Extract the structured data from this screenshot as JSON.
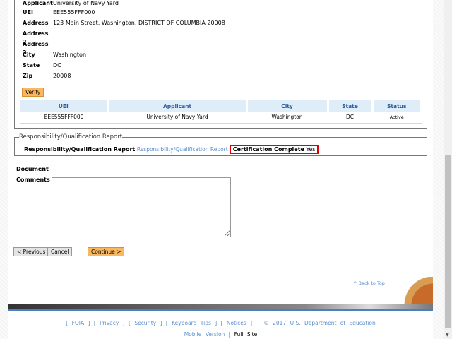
{
  "applicant_details": [
    {
      "label": "Applicant",
      "value": "University of Navy Yard"
    },
    {
      "label": "UEI",
      "value": "EEE555FFF000"
    },
    {
      "label": "Address",
      "value": "123 Main Street, Washington, DISTRICT OF COLUMBIA 20008"
    },
    {
      "label": "Address 2",
      "value": ""
    },
    {
      "label": "Address 3",
      "value": ""
    },
    {
      "label": "City",
      "value": "Washington"
    },
    {
      "label": "State",
      "value": "DC"
    },
    {
      "label": "Zip",
      "value": "20008"
    }
  ],
  "verify_label": "Verify",
  "table": {
    "headers": [
      "UEI",
      "Applicant",
      "City",
      "State",
      "Status"
    ],
    "rows": [
      [
        "EEE555FFF000",
        "University of Navy Yard",
        "Washington",
        "DC",
        "Active"
      ]
    ]
  },
  "report": {
    "legend": "Responsibility/Qualification Report",
    "label": "Responsibility/Qualification Report",
    "link": "Responsibility/Qualification Report",
    "cert_label": "Certification Complete",
    "cert_value": "Yes"
  },
  "document_label": "Document",
  "comments_label": "Comments",
  "comments_value": "",
  "buttons": {
    "previous": "< Previous",
    "cancel": "Cancel",
    "continue": "Continue >"
  },
  "back_to_top": "^ Back to Top",
  "footer": {
    "links": [
      "FOIA",
      "Privacy",
      "Security",
      "Keyboard Tips",
      "Notices"
    ],
    "copyright": "© 2017 U.S. Department of Education",
    "mobile": "Mobile Version",
    "full": "Full Site"
  },
  "colors": {
    "accent": "#f8b760",
    "link": "#5b8fd0",
    "highlight": "#e00000"
  }
}
